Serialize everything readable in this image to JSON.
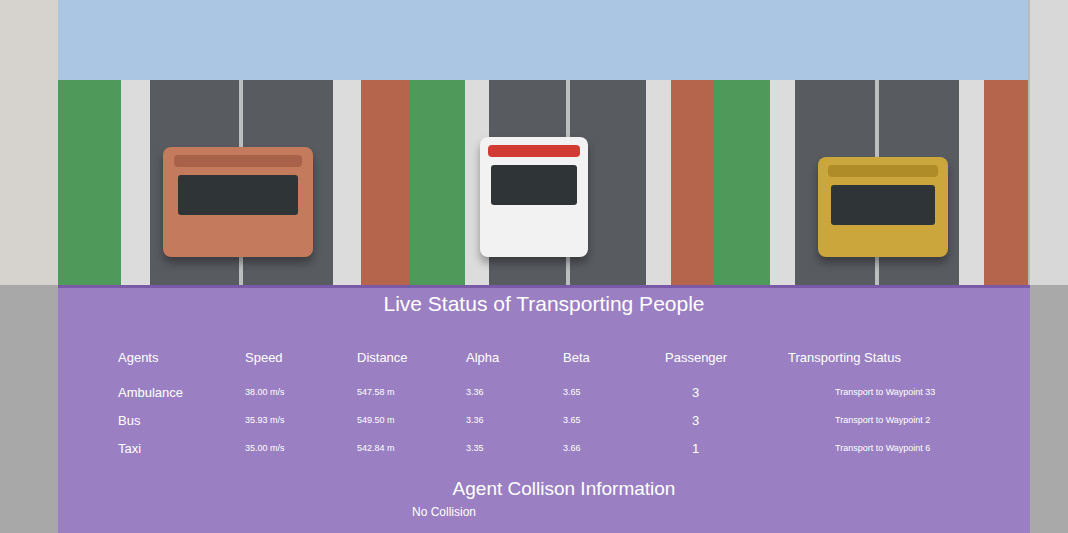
{
  "panel": {
    "title": "Live Status of Transporting People"
  },
  "table": {
    "columns": [
      "Agents",
      "Speed",
      "Distance",
      "Alpha",
      "Beta",
      "Passenger",
      "Transporting Status"
    ],
    "rows": [
      {
        "agent": "Ambulance",
        "speed": "38.00 m/s",
        "distance": "547.58 m",
        "alpha": "3.36",
        "beta": "3.65",
        "passenger": "3",
        "status": "Transport to Waypoint 33"
      },
      {
        "agent": "Bus",
        "speed": "35.93 m/s",
        "distance": "549.50 m",
        "alpha": "3.36",
        "beta": "3.65",
        "passenger": "3",
        "status": "Transport to Waypoint 2"
      },
      {
        "agent": "Taxi",
        "speed": "35.00 m/s",
        "distance": "542.84 m",
        "alpha": "3.35",
        "beta": "3.66",
        "passenger": "1",
        "status": "Transport to Waypoint 6"
      }
    ]
  },
  "collision": {
    "title": "Agent Collison Information",
    "message": "No Collision"
  }
}
